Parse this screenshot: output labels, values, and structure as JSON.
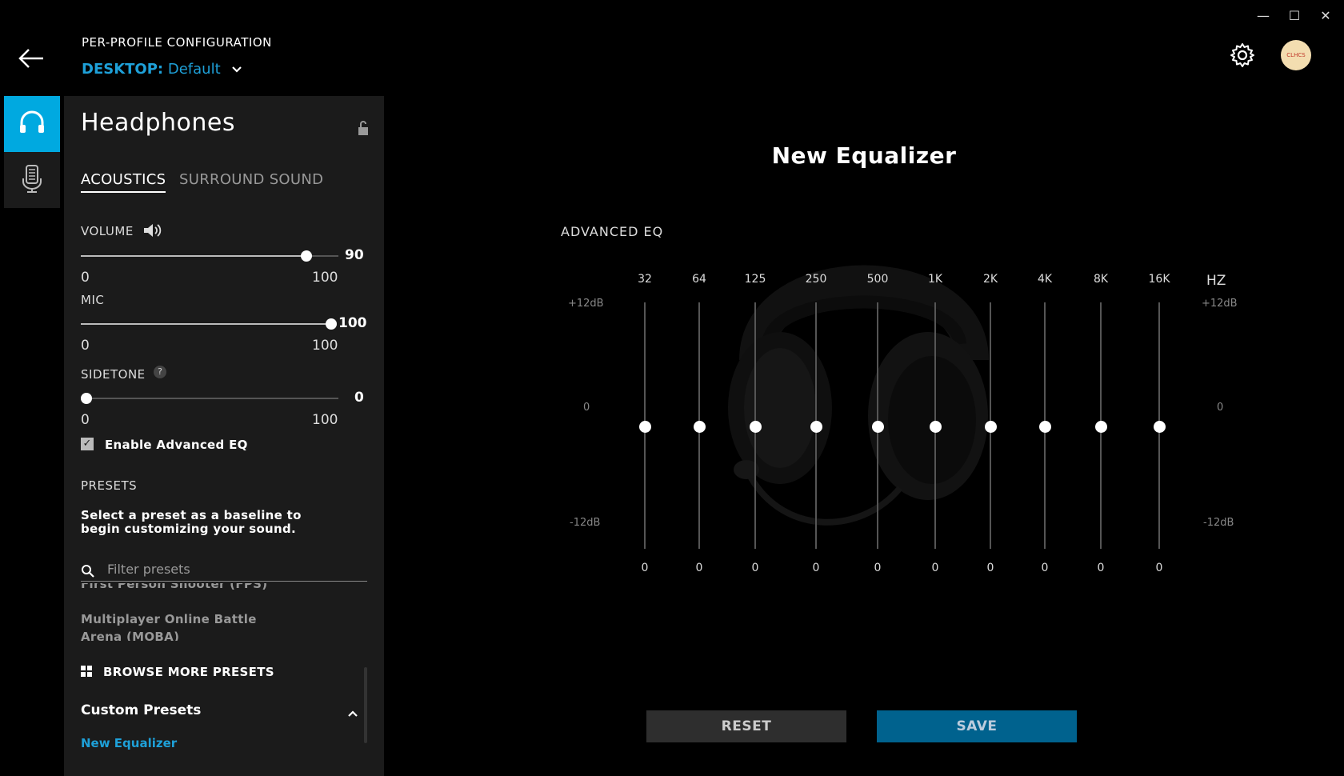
{
  "window": {
    "min": "—",
    "max": "☐",
    "close": "✕"
  },
  "header": {
    "title": "PER-PROFILE CONFIGURATION",
    "profile_prefix": "DESKTOP:",
    "profile_name": "Default",
    "avatar_text": "CLHCS"
  },
  "panel": {
    "title": "Headphones",
    "tabs": [
      {
        "label": "ACOUSTICS"
      },
      {
        "label": "SURROUND SOUND"
      }
    ],
    "volume": {
      "label": "VOLUME",
      "min": "0",
      "max": "100",
      "value": "90"
    },
    "mic": {
      "label": "MIC",
      "min": "0",
      "max": "100",
      "value": "100"
    },
    "sidetone": {
      "label": "SIDETONE",
      "min": "0",
      "max": "100",
      "value": "0",
      "help": "?"
    },
    "advanced_eq_label": "Enable Advanced EQ",
    "presets_label": "PRESETS",
    "presets_desc": "Select a preset as a baseline to begin customizing your sound.",
    "filter_placeholder": "Filter presets",
    "preset_items": [
      "First Person Shooter (FPS)",
      "Multiplayer Online Battle Arena (MOBA)"
    ],
    "browse_label": "BROWSE MORE PRESETS",
    "custom_label": "Custom Presets",
    "custom_items": [
      "New Equalizer"
    ]
  },
  "eq": {
    "title": "New Equalizer",
    "advanced_label": "ADVANCED EQ",
    "unit": "HZ",
    "db_top": "+12dB",
    "db_mid": "0",
    "db_bot": "-12dB",
    "bands": [
      {
        "freq": "32",
        "value": "0"
      },
      {
        "freq": "64",
        "value": "0"
      },
      {
        "freq": "125",
        "value": "0"
      },
      {
        "freq": "250",
        "value": "0"
      },
      {
        "freq": "500",
        "value": "0"
      },
      {
        "freq": "1K",
        "value": "0"
      },
      {
        "freq": "2K",
        "value": "0"
      },
      {
        "freq": "4K",
        "value": "0"
      },
      {
        "freq": "8K",
        "value": "0"
      },
      {
        "freq": "16K",
        "value": "0"
      }
    ],
    "reset_label": "RESET",
    "save_label": "SAVE"
  },
  "colors": {
    "accent": "#00a9e0",
    "save": "#00628e",
    "panel": "#1b1b1b"
  },
  "icons": [
    "back-arrow-icon",
    "gear-icon",
    "headphones-icon",
    "microphone-icon",
    "lock-icon",
    "speaker-icon",
    "help-icon",
    "search-icon",
    "grid-icon",
    "chevron-up-icon",
    "chevron-down-icon"
  ]
}
